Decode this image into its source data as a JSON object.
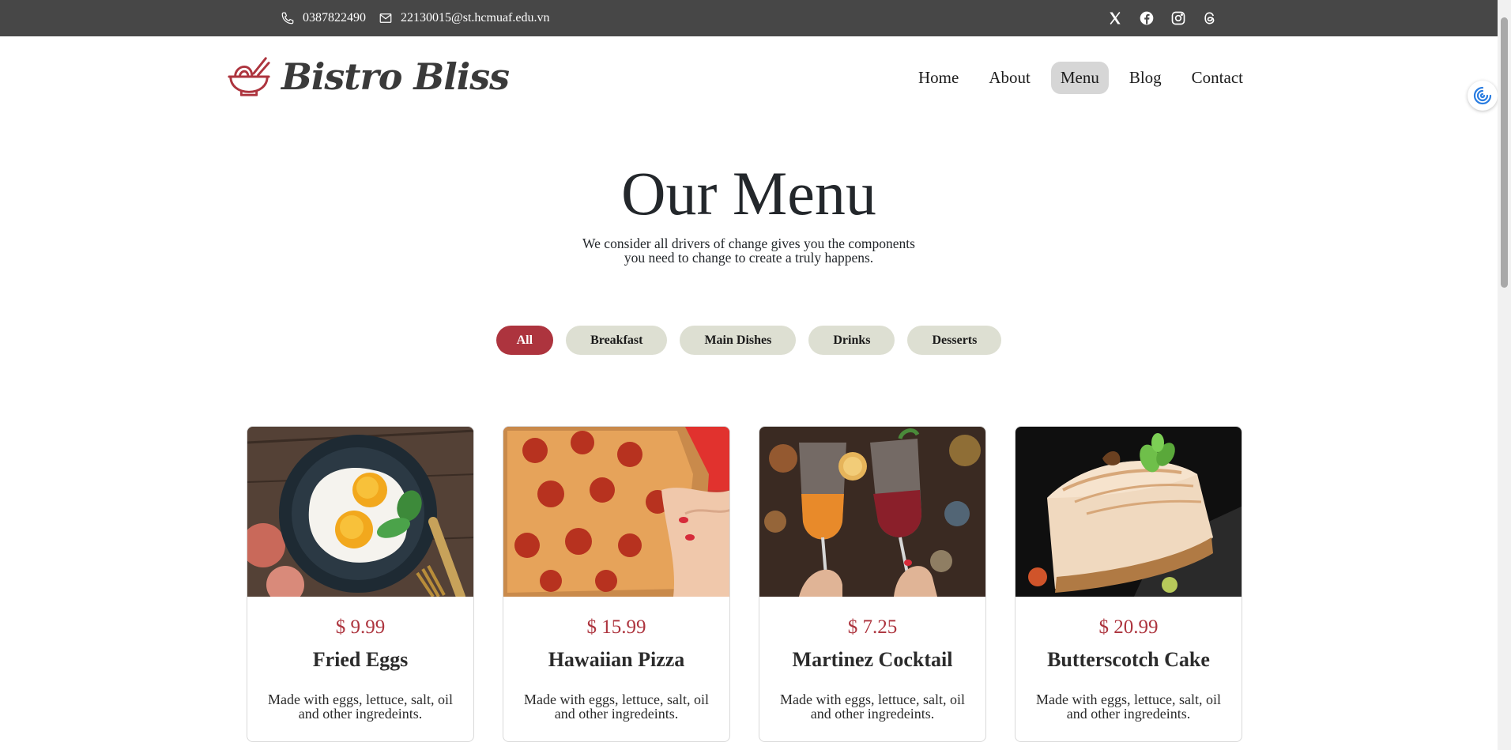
{
  "topbar": {
    "phone": "0387822490",
    "email": "22130015@st.hcmuaf.edu.vn",
    "social_icons": [
      "x-icon",
      "facebook-icon",
      "instagram-icon",
      "threads-icon"
    ]
  },
  "brand": {
    "name": "Bistro Bliss"
  },
  "nav": {
    "items": [
      {
        "label": "Home",
        "active": false
      },
      {
        "label": "About",
        "active": false
      },
      {
        "label": "Menu",
        "active": true
      },
      {
        "label": "Blog",
        "active": false
      },
      {
        "label": "Contact",
        "active": false
      }
    ]
  },
  "hero": {
    "title": "Our Menu",
    "subtitle_line1": "We consider all drivers of change gives you the components",
    "subtitle_line2": "you need to change to create a truly happens."
  },
  "filters": [
    {
      "label": "All",
      "active": true
    },
    {
      "label": "Breakfast",
      "active": false
    },
    {
      "label": "Main Dishes",
      "active": false
    },
    {
      "label": "Drinks",
      "active": false
    },
    {
      "label": "Desserts",
      "active": false
    }
  ],
  "menu_items": [
    {
      "price": "$ 9.99",
      "name": "Fried Eggs",
      "desc": "Made with eggs, lettuce, salt, oil and other ingredeints."
    },
    {
      "price": "$ 15.99",
      "name": "Hawaiian Pizza",
      "desc": "Made with eggs, lettuce, salt, oil and other ingredeints."
    },
    {
      "price": "$ 7.25",
      "name": "Martinez Cocktail",
      "desc": "Made with eggs, lettuce, salt, oil and other ingredeints."
    },
    {
      "price": "$ 20.99",
      "name": "Butterscotch Cake",
      "desc": "Made with eggs, lettuce, salt, oil and other ingredeints."
    }
  ],
  "colors": {
    "topbar_bg": "#474747",
    "accent": "#ad343e",
    "filter_bg": "#dddfd2",
    "nav_active_bg": "#d6d6d6"
  }
}
